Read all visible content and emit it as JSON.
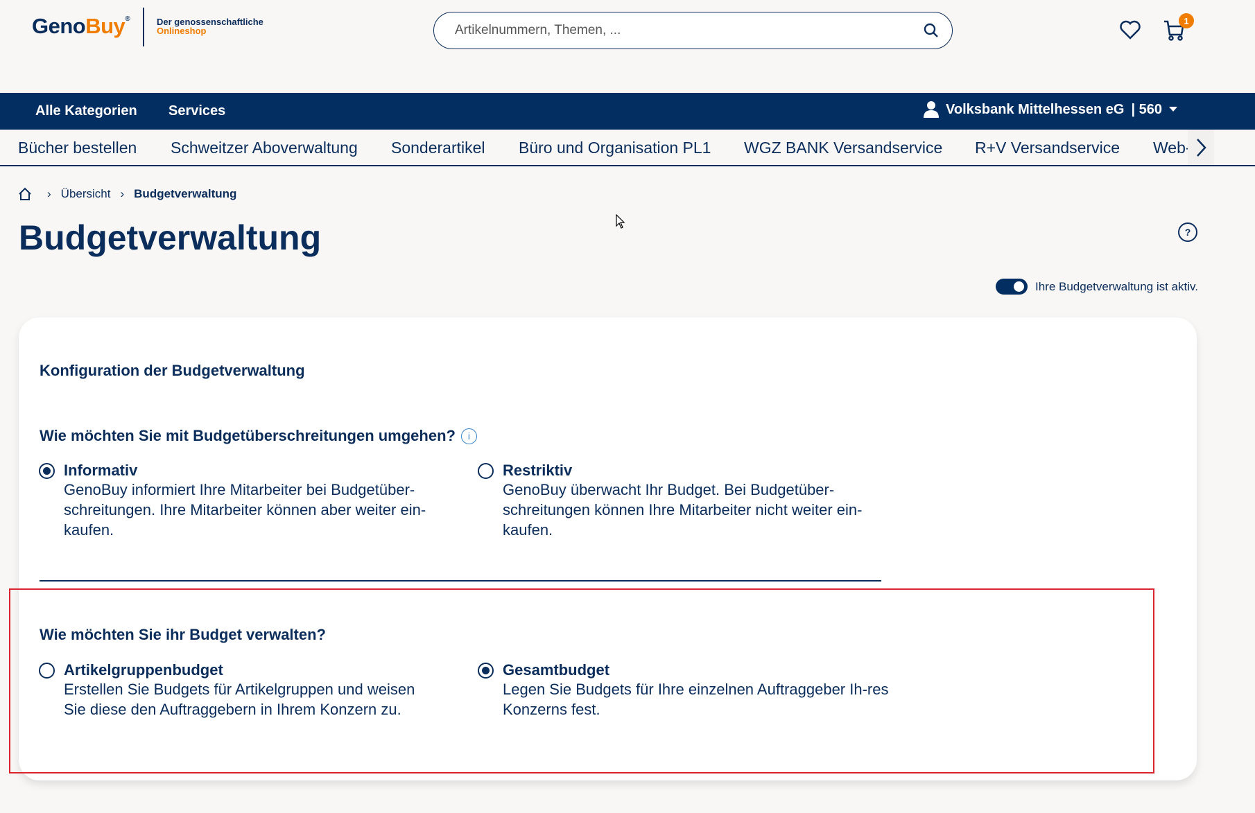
{
  "header": {
    "logo_geno": "Geno",
    "logo_buy": "Buy",
    "logo_reg": "®",
    "tagline_1": "Der genossenschaftliche",
    "tagline_2": "Onlineshop",
    "search_placeholder": "Artikelnummern, Themen, ...",
    "cart_count": "1"
  },
  "nav": {
    "items": [
      "Alle Kategorien",
      "Services"
    ],
    "user": "Volksbank Mittelhessen eG",
    "user_number": "| 560"
  },
  "subnav": [
    "Bücher bestellen",
    "Schweitzer Aboverwaltung",
    "Sonderartikel",
    "Büro und Organisation PL1",
    "WGZ BANK Versandservice",
    "R+V Versandservice",
    "Web-"
  ],
  "breadcrumb": [
    "Übersicht",
    "Budgetverwaltung"
  ],
  "page_title": "Budgetverwaltung",
  "toggle": {
    "label": "Ihre Budgetverwaltung ist aktiv.",
    "on": true
  },
  "card": {
    "title": "Konfiguration der Budgetverwaltung",
    "q1": {
      "question": "Wie möchten Sie mit Budgetüberschreitungen umgehen?",
      "options": [
        {
          "label": "Informativ",
          "desc": "GenoBuy informiert Ihre Mitarbeiter bei Budgetüber-schreitungen. Ihre Mitarbeiter können aber weiter ein-kaufen.",
          "selected": true
        },
        {
          "label": "Restriktiv",
          "desc": "GenoBuy überwacht Ihr Budget. Bei Budgetüber-schreitungen können Ihre Mitarbeiter nicht weiter ein-kaufen.",
          "selected": false
        }
      ]
    },
    "q2": {
      "question": "Wie möchten Sie ihr Budget verwalten?",
      "options": [
        {
          "label": "Artikelgruppenbudget",
          "desc": "Erstellen Sie Budgets für Artikelgruppen und weisen Sie diese den Auftraggebern in Ihrem Konzern zu.",
          "selected": false
        },
        {
          "label": "Gesamtbudget",
          "desc": "Legen Sie Budgets für Ihre einzelnen Auftraggeber Ih-res Konzerns fest.",
          "selected": true
        }
      ]
    }
  }
}
